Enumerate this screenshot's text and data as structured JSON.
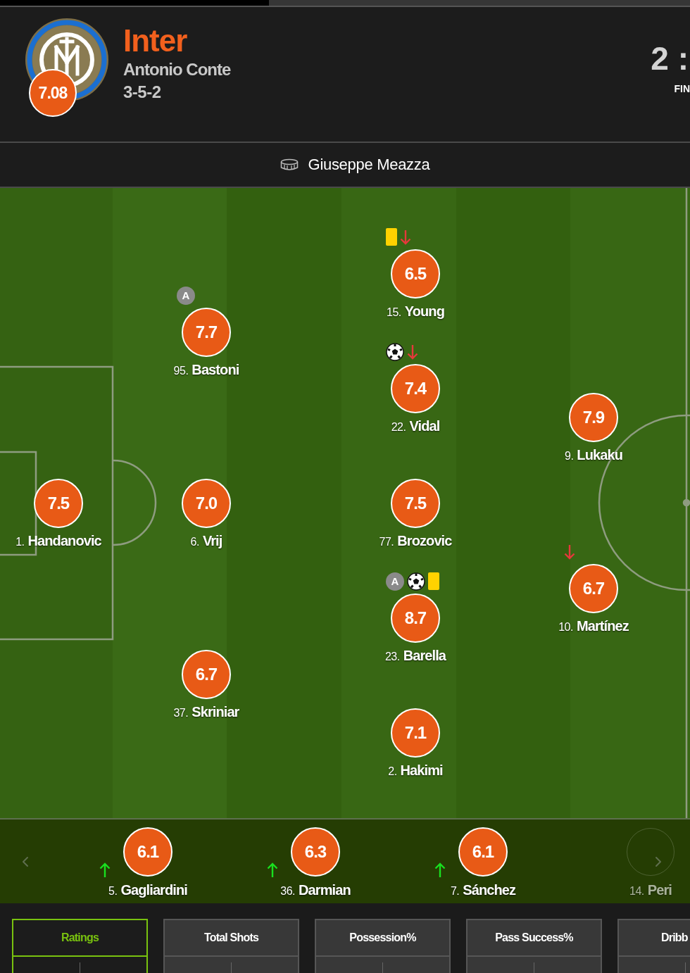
{
  "team": {
    "name": "Inter",
    "manager": "Antonio Conte",
    "formation": "3-5-2",
    "rating": "7.08"
  },
  "score": {
    "value": "2 :",
    "status": "FIN"
  },
  "venue": {
    "name": "Giuseppe Meazza"
  },
  "lines": [
    {
      "players": [
        {
          "number": "1.",
          "name": "Handanovic",
          "rating": "7.5"
        }
      ]
    },
    {
      "players": [
        {
          "number": "95.",
          "name": "Bastoni",
          "rating": "7.7",
          "events": [
            {
              "kind": "assist",
              "label": "A"
            }
          ]
        },
        {
          "number": "6.",
          "name": "Vrij",
          "rating": "7.0"
        },
        {
          "number": "37.",
          "name": "Skriniar",
          "rating": "6.7"
        }
      ]
    },
    {
      "players": [
        {
          "number": "15.",
          "name": "Young",
          "rating": "6.5",
          "events": [
            {
              "kind": "yellow_card"
            },
            {
              "kind": "subbed_off"
            }
          ]
        },
        {
          "number": "22.",
          "name": "Vidal",
          "rating": "7.4",
          "events": [
            {
              "kind": "goal"
            },
            {
              "kind": "subbed_off"
            }
          ]
        },
        {
          "number": "77.",
          "name": "Brozovic",
          "rating": "7.5"
        },
        {
          "number": "23.",
          "name": "Barella",
          "rating": "8.7",
          "events": [
            {
              "kind": "assist",
              "label": "A"
            },
            {
              "kind": "goal"
            },
            {
              "kind": "yellow_card"
            }
          ]
        },
        {
          "number": "2.",
          "name": "Hakimi",
          "rating": "7.1"
        }
      ]
    },
    {
      "players": [
        {
          "number": "9.",
          "name": "Lukaku",
          "rating": "7.9"
        },
        {
          "number": "10.",
          "name": "Martínez",
          "rating": "6.7",
          "events": [
            {
              "kind": "subbed_off"
            }
          ]
        }
      ]
    }
  ],
  "bench": [
    {
      "number": "5.",
      "name": "Gagliardini",
      "rating": "6.1",
      "subbed_on": true,
      "dimmed": false
    },
    {
      "number": "36.",
      "name": "Darmian",
      "rating": "6.3",
      "subbed_on": true,
      "dimmed": false
    },
    {
      "number": "7.",
      "name": "Sánchez",
      "rating": "6.1",
      "subbed_on": true,
      "dimmed": false
    },
    {
      "number": "14.",
      "name": "Peri",
      "subbed_on": false,
      "dimmed": true
    }
  ],
  "stat_tabs": [
    {
      "label": "Ratings",
      "selected": true
    },
    {
      "label": "Total Shots",
      "selected": false
    },
    {
      "label": "Possession%",
      "selected": false
    },
    {
      "label": "Pass Success%",
      "selected": false
    },
    {
      "label": "Dribb",
      "selected": false
    }
  ]
}
